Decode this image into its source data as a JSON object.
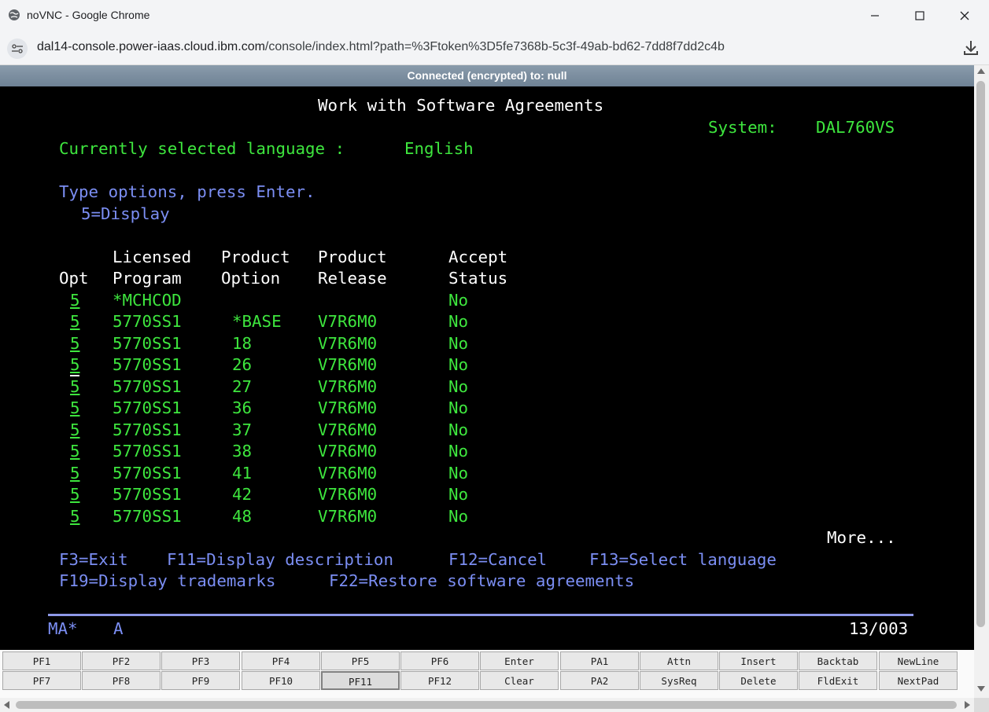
{
  "window": {
    "title": "noVNC - Google Chrome"
  },
  "address_bar": {
    "host": "dal14-console.power-iaas.cloud.ibm.com",
    "path": "/console/index.html?path=%3Ftoken%3D5fe7368b-5c3f-49ab-bd62-7dd8f7dd2c4b"
  },
  "novnc": {
    "status": "Connected (encrypted) to: null"
  },
  "screen": {
    "title": "Work with Software Agreements",
    "system_label": "System:",
    "system_value": "DAL760VS",
    "language_label": "Currently selected language :",
    "language_value": "English",
    "instructions": "Type options, press Enter.",
    "option_hint": "5=Display",
    "headers": {
      "opt": "Opt",
      "program_line1": "Licensed",
      "program_line2": "Program",
      "option_line1": "Product",
      "option_line2": "Option",
      "release_line1": "Product",
      "release_line2": "Release",
      "status_line1": "Accept",
      "status_line2": "Status"
    },
    "rows": [
      {
        "opt": "5",
        "program": "*MCHCOD",
        "option": "",
        "release": "",
        "status": "No"
      },
      {
        "opt": "5",
        "program": "5770SS1",
        "option": "*BASE",
        "release": "V7R6M0",
        "status": "No"
      },
      {
        "opt": "5",
        "program": "5770SS1",
        "option": "18",
        "release": "V7R6M0",
        "status": "No"
      },
      {
        "opt": "5",
        "program": "5770SS1",
        "option": "26",
        "release": "V7R6M0",
        "status": "No"
      },
      {
        "opt": "5",
        "program": "5770SS1",
        "option": "27",
        "release": "V7R6M0",
        "status": "No"
      },
      {
        "opt": "5",
        "program": "5770SS1",
        "option": "36",
        "release": "V7R6M0",
        "status": "No"
      },
      {
        "opt": "5",
        "program": "5770SS1",
        "option": "37",
        "release": "V7R6M0",
        "status": "No"
      },
      {
        "opt": "5",
        "program": "5770SS1",
        "option": "38",
        "release": "V7R6M0",
        "status": "No"
      },
      {
        "opt": "5",
        "program": "5770SS1",
        "option": "41",
        "release": "V7R6M0",
        "status": "No"
      },
      {
        "opt": "5",
        "program": "5770SS1",
        "option": "42",
        "release": "V7R6M0",
        "status": "No"
      },
      {
        "opt": "5",
        "program": "5770SS1",
        "option": "48",
        "release": "V7R6M0",
        "status": "No"
      }
    ],
    "more": "More...",
    "fkeys_line1": [
      {
        "label": "F3=Exit"
      },
      {
        "label": "F11=Display description"
      },
      {
        "label": "F12=Cancel"
      },
      {
        "label": "F13=Select language"
      }
    ],
    "fkeys_line2": [
      {
        "label": "F19=Display trademarks"
      },
      {
        "label": "F22=Restore software agreements"
      }
    ],
    "oia": {
      "left": "MA*",
      "mode": "A",
      "position": "13/003"
    }
  },
  "keypad": {
    "row1": [
      "PF1",
      "PF2",
      "PF3",
      "PF4",
      "PF5",
      "PF6",
      "Enter",
      "PA1",
      "Attn",
      "Insert",
      "Backtab",
      "NewLine"
    ],
    "row2": [
      "PF7",
      "PF8",
      "PF9",
      "PF10",
      "PF11",
      "PF12",
      "Clear",
      "PA2",
      "SysReq",
      "Delete",
      "FldExit",
      "NextPad"
    ]
  },
  "colors": {
    "terminal_bg": "#000000",
    "terminal_green": "#3ee63e",
    "terminal_blue": "#7b8ef3",
    "terminal_white": "#ffffff"
  }
}
